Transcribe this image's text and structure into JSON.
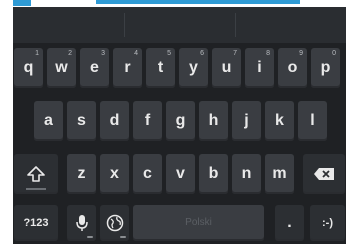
{
  "colors": {
    "accent": "#2f9bd5",
    "keyboard_bg": "#1f2124",
    "key_bg": "#3a3d42",
    "key_text": "#e9e9e9"
  },
  "keyboard": {
    "row1": [
      {
        "letter": "q",
        "hint": "1"
      },
      {
        "letter": "w",
        "hint": "2"
      },
      {
        "letter": "e",
        "hint": "3"
      },
      {
        "letter": "r",
        "hint": "4"
      },
      {
        "letter": "t",
        "hint": "5"
      },
      {
        "letter": "y",
        "hint": "6"
      },
      {
        "letter": "u",
        "hint": "7"
      },
      {
        "letter": "i",
        "hint": "8"
      },
      {
        "letter": "o",
        "hint": "9"
      },
      {
        "letter": "p",
        "hint": "0"
      }
    ],
    "row2": [
      "a",
      "s",
      "d",
      "f",
      "g",
      "h",
      "j",
      "k",
      "l"
    ],
    "row3": [
      "z",
      "x",
      "c",
      "v",
      "b",
      "n",
      "m"
    ],
    "symbols_label": "?123",
    "space_label": "Polski",
    "period_label": ".",
    "emoticon_label": ":-)",
    "icons": {
      "shift": "shift-icon",
      "backspace": "backspace-icon",
      "mic": "microphone-icon",
      "globe": "globe-icon"
    }
  }
}
